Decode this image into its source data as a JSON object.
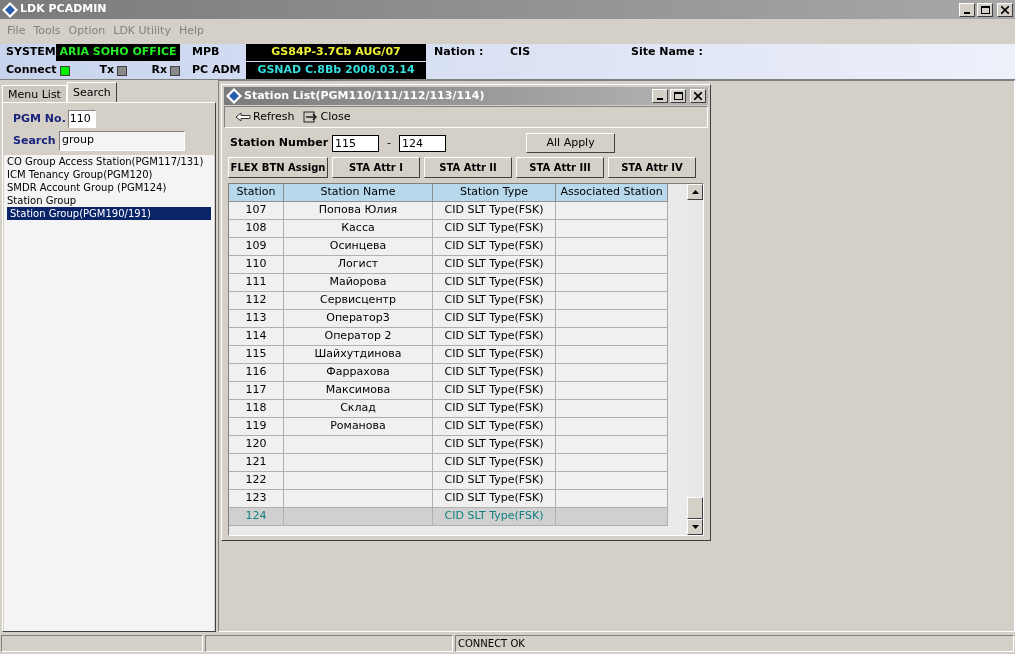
{
  "window": {
    "title": "LDK PCADMIN"
  },
  "menu": [
    "File",
    "Tools",
    "Option",
    "LDK Utility",
    "Help"
  ],
  "info": {
    "system_label": "SYSTEM",
    "system": "ARIA SOHO OFFICE",
    "mpb_label": "MPB",
    "mpb": "GS84P-3.7Cb AUG/07",
    "nation_label": "Nation :",
    "nation": "CIS",
    "site_label": "Site Name :",
    "pcadm_label": "PC ADM",
    "pcadm": "GSNAD C.8Bb 2008.03.14",
    "indicators": [
      {
        "label": "Connect",
        "on": true
      },
      {
        "label": "Tx",
        "on": false
      },
      {
        "label": "Rx",
        "on": false
      }
    ]
  },
  "left_tabs": [
    {
      "label": "Menu List",
      "selected": false
    },
    {
      "label": "Search",
      "selected": true
    }
  ],
  "pgm_label": "PGM No.",
  "pgm": "110",
  "search_label": "Search",
  "search": "group",
  "results": [
    {
      "label": "CO Group Access Station(PGM117/131)",
      "selected": false
    },
    {
      "label": "ICM Tenancy Group(PGM120)",
      "selected": false
    },
    {
      "label": "SMDR Account Group (PGM124)",
      "selected": false
    },
    {
      "label": "Station Group",
      "selected": false
    },
    {
      "label": "Station Group(PGM190/191)",
      "selected": true
    }
  ],
  "station_window": {
    "title": "Station List(PGM110/111/112/113/114)",
    "toolbar": [
      "Refresh",
      "Close"
    ],
    "range_label": "Station Number",
    "from": "115",
    "dash": "-",
    "to": "124",
    "apply": "All Apply",
    "attr_buttons": [
      "FLEX BTN Assign",
      "STA Attr I",
      "STA Attr II",
      "STA Attr III",
      "STA Attr IV"
    ],
    "columns": [
      "Station",
      "Station Name",
      "Station Type",
      "Associated Station"
    ],
    "rows": [
      {
        "station": "107",
        "name": "Попова Юлия",
        "type": "CID SLT Type(FSK)",
        "selected": false
      },
      {
        "station": "108",
        "name": "Касса",
        "type": "CID SLT Type(FSK)",
        "selected": false
      },
      {
        "station": "109",
        "name": "Осинцева",
        "type": "CID SLT Type(FSK)",
        "selected": false
      },
      {
        "station": "110",
        "name": "Логист",
        "type": "CID SLT Type(FSK)",
        "selected": false
      },
      {
        "station": "111",
        "name": "Майорова",
        "type": "CID SLT Type(FSK)",
        "selected": false
      },
      {
        "station": "112",
        "name": "Сервисцентр",
        "type": "CID SLT Type(FSK)",
        "selected": false
      },
      {
        "station": "113",
        "name": "Оператор3",
        "type": "CID SLT Type(FSK)",
        "selected": false
      },
      {
        "station": "114",
        "name": "Оператор 2",
        "type": "CID SLT Type(FSK)",
        "selected": false
      },
      {
        "station": "115",
        "name": "Шайхутдинова",
        "type": "CID SLT Type(FSK)",
        "selected": false
      },
      {
        "station": "116",
        "name": "Фаррахова",
        "type": "CID SLT Type(FSK)",
        "selected": false
      },
      {
        "station": "117",
        "name": "Максимова",
        "type": "CID SLT Type(FSK)",
        "selected": false
      },
      {
        "station": "118",
        "name": "Склад",
        "type": "CID SLT Type(FSK)",
        "selected": false
      },
      {
        "station": "119",
        "name": "Романова",
        "type": "CID SLT Type(FSK)",
        "selected": false
      },
      {
        "station": "120",
        "type": "CID SLT Type(FSK)",
        "selected": false
      },
      {
        "station": "121",
        "type": "CID SLT Type(FSK)",
        "selected": false
      },
      {
        "station": "122",
        "type": "CID SLT Type(FSK)",
        "selected": false
      },
      {
        "station": "123",
        "type": "CID SLT Type(FSK)",
        "selected": false
      },
      {
        "station": "124",
        "type": "CID SLT Type(FSK)",
        "selected": true
      }
    ]
  },
  "status_bar": {
    "message": "CONNECT OK"
  }
}
